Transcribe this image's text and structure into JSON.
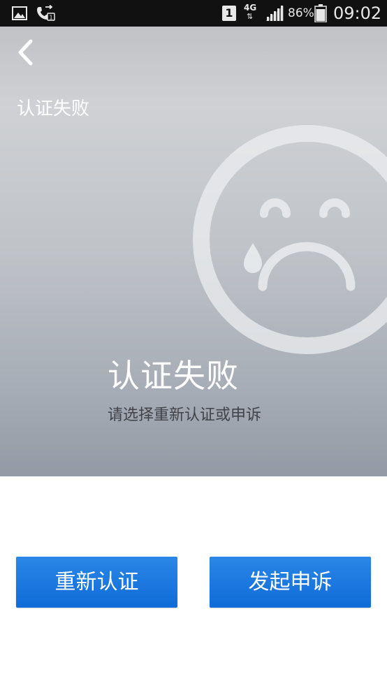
{
  "status_bar": {
    "sim_slot": "1",
    "network_type": "4G",
    "network_arrows": "⇅",
    "battery_percent": "86%",
    "time": "09:02",
    "icons": [
      "gallery-icon",
      "call-forward-icon",
      "signal-icon",
      "battery-icon"
    ]
  },
  "header": {
    "back_icon": "chevron-left-icon",
    "title": "认证失败"
  },
  "result": {
    "icon": "sad-crying-face-icon",
    "title": "认证失败",
    "subtitle": "请选择重新认证或申诉"
  },
  "actions": {
    "reauth_label": "重新认证",
    "appeal_label": "发起申诉"
  },
  "colors": {
    "status_bar_bg": "#111111",
    "button_blue": "#1572dc",
    "hero_top": "#c8cacd",
    "hero_bottom": "#939aa5"
  }
}
